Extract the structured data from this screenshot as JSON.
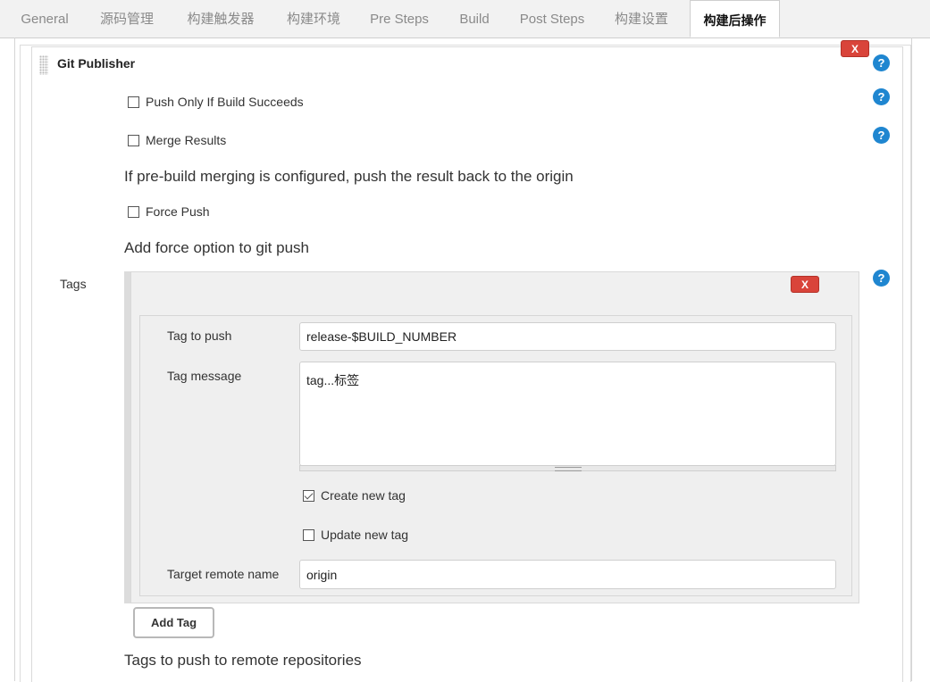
{
  "tabs": [
    "General",
    "源码管理",
    "构建触发器",
    "构建环境",
    "Pre Steps",
    "Build",
    "Post Steps",
    "构建设置",
    "构建后操作"
  ],
  "publisher": {
    "title": "Git Publisher",
    "delete_label": "X",
    "help_label": "?",
    "push_only_label": "Push Only If Build Succeeds",
    "merge_results_label": "Merge Results",
    "merge_desc": "If pre-build merging is configured, push the result back to the origin",
    "force_push_label": "Force Push",
    "force_desc": "Add force option to git push"
  },
  "tags": {
    "label": "Tags",
    "delete_label": "X",
    "tag_to_push_label": "Tag to push",
    "tag_to_push_value": "release-$BUILD_NUMBER",
    "tag_message_label": "Tag message",
    "tag_message_value": "tag...标签",
    "create_new_tag_label": "Create new tag",
    "update_new_tag_label": "Update new tag",
    "target_remote_label": "Target remote name",
    "target_remote_value": "origin",
    "add_tag_label": "Add Tag",
    "desc": "Tags to push to remote repositories"
  }
}
